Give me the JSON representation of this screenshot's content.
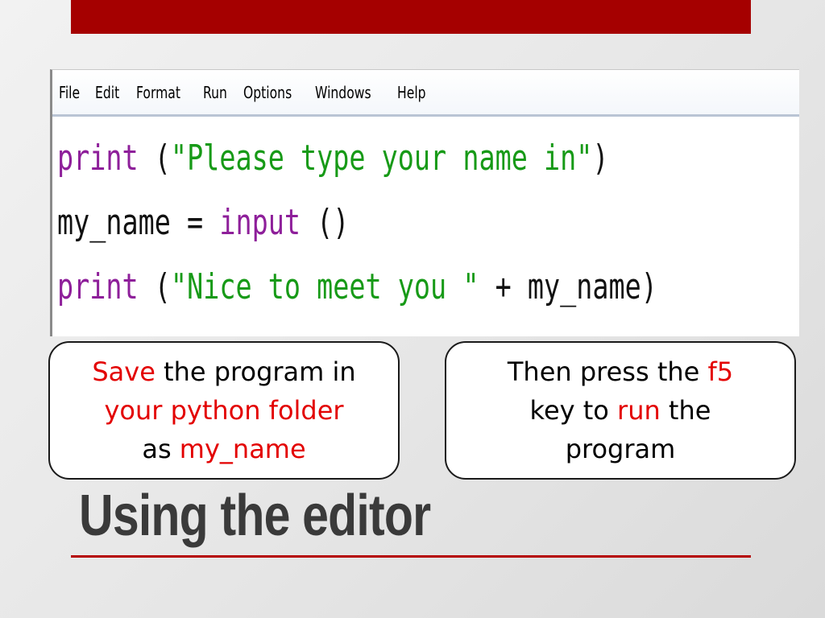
{
  "menu": {
    "items": [
      "File",
      "Edit",
      "Format",
      "Run",
      "Options",
      "Windows",
      "Help"
    ]
  },
  "code": {
    "line1": {
      "kw": "print",
      "open": " (",
      "str": "\"Please type your name in\"",
      "close": ")"
    },
    "line2": {
      "lhs": "my_name = ",
      "kw": "input",
      "rest": " ()"
    },
    "line3": {
      "kw": "print",
      "open": " (",
      "str": "\"Nice to meet you \"",
      "rest": " + my_name)"
    }
  },
  "callout_left": {
    "w1": "Save",
    "t1": " the program in",
    "w2": "your python folder",
    "t3": "as ",
    "w3": "my_name"
  },
  "callout_right": {
    "t1": "Then press the ",
    "w1": "f5",
    "t2": "key to ",
    "w2": "run",
    "t2b": " the",
    "t3": "program"
  },
  "slide": {
    "title": "Using the editor"
  },
  "colors": {
    "accent": "#a50000",
    "keyword": "#8e1f9a",
    "string": "#179a17",
    "highlight": "#e30000",
    "title": "#3a3a3a"
  }
}
